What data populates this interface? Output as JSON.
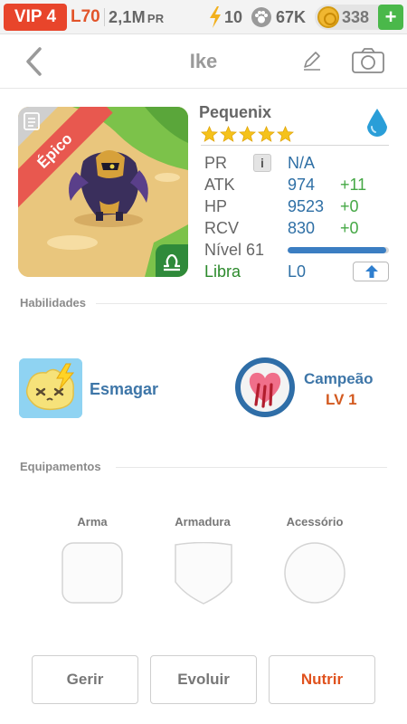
{
  "status_bar": {
    "vip": "VIP 4",
    "level": "L70",
    "power_value": "2,1M",
    "power_unit": "PR",
    "energy": "10",
    "food": "67K",
    "coins": "338",
    "add_label": "+"
  },
  "header": {
    "title": "Ike",
    "back_icon": "chevron-left-icon",
    "edit_icon": "pencil-icon",
    "camera_icon": "camera-icon"
  },
  "monster": {
    "rarity": "Épico",
    "species": "Pequenix",
    "stars": 5,
    "element_icon": "water-drop-icon",
    "zodiac_icon": "libra-icon",
    "colors": {
      "accent": "#2e6fa5",
      "bonus": "#45a845",
      "rarity": "#e8584f",
      "zodiac_bg": "#2f8a3a"
    },
    "stats": {
      "pr": {
        "label": "PR",
        "info": "i",
        "value": "N/A"
      },
      "atk": {
        "label": "ATK",
        "value": "974",
        "bonus": "+11"
      },
      "hp": {
        "label": "HP",
        "value": "9523",
        "bonus": "+0"
      },
      "rcv": {
        "label": "RCV",
        "value": "830",
        "bonus": "+0"
      },
      "level": {
        "label": "Nível 61",
        "xp_fraction": 0.97
      },
      "sign": {
        "label": "Libra",
        "value": "L0"
      }
    }
  },
  "skills": {
    "title": "Habilidades",
    "items": [
      {
        "name": "Esmagar",
        "icon": "smash-skill-icon"
      },
      {
        "name": "Campeão",
        "level": "LV 1",
        "icon": "champion-heart-icon"
      }
    ]
  },
  "equipment": {
    "title": "Equipamentos",
    "slots": [
      {
        "label": "Arma",
        "icon": "weapon-slot-icon"
      },
      {
        "label": "Armadura",
        "icon": "armor-slot-icon"
      },
      {
        "label": "Acessório",
        "icon": "accessory-slot-icon"
      }
    ]
  },
  "actions": {
    "manage": "Gerir",
    "evolve": "Evoluir",
    "feed": "Nutrir"
  }
}
